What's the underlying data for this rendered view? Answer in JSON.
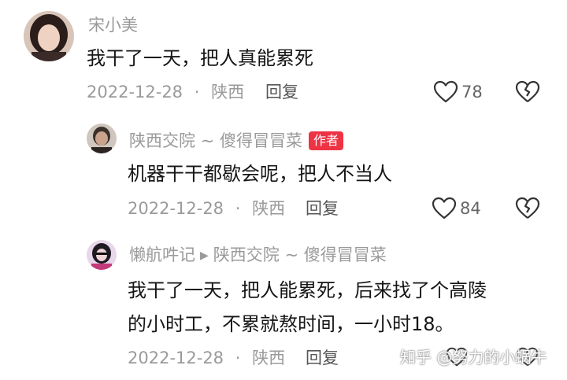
{
  "comments": [
    {
      "username": "宋小美",
      "text_lines": [
        "我干了一天，把人真能累死"
      ],
      "date": "2022-12-28",
      "separator": "·",
      "location": "陕西",
      "reply_label": "回复",
      "likes": "78"
    },
    {
      "username": "陕西交院 ~ 傻得冒冒菜",
      "badge": "作者",
      "text_lines": [
        "机器干干都歇会呢，把人不当人"
      ],
      "date": "2022-12-28",
      "separator": "·",
      "location": "陕西",
      "reply_label": "回复",
      "likes": "84"
    },
    {
      "username": "懒航吽记",
      "reply_to": "陕西交院 ~ 傻得冒冒菜",
      "text_lines": [
        "我干了一天，把人能累死，后来找了个高陵",
        "的小时工，不累就熬时间，一小时18。"
      ],
      "date": "2022-12-28",
      "separator": "·",
      "location": "陕西",
      "reply_label": "回复"
    }
  ],
  "watermark": "知乎 @努力的小蜗牛",
  "colors": {
    "meta_gray": "#9a9a9a",
    "text": "#161616",
    "badge_red": "#ee3344"
  },
  "icons": [
    "heart-outline-icon",
    "broken-heart-icon",
    "play-arrow-icon"
  ]
}
